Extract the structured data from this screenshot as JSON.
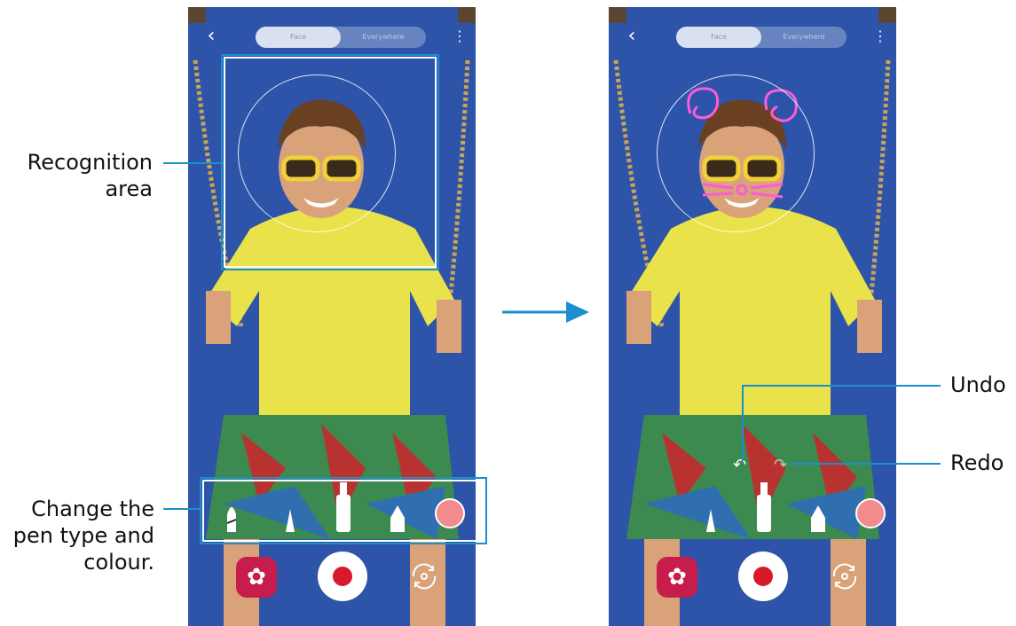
{
  "screens": [
    {
      "id": "before",
      "header": {
        "mode_tabs": [
          "Face",
          "Everywhere"
        ],
        "selected_tab": "Face"
      },
      "pen_options": {
        "pens": [
          "brush-pen",
          "marker-pen",
          "bottle-pen",
          "highlighter-pen"
        ],
        "selected_color": "#f08b8e"
      },
      "controls": {
        "sticker_icon": "flower-icon",
        "record_icon": "record-icon",
        "switch_icon": "switch-camera-icon"
      }
    },
    {
      "id": "after",
      "header": {
        "mode_tabs": [
          "Face",
          "Everywhere"
        ],
        "selected_tab": "Face"
      },
      "pen_options": {
        "pens": [
          "marker-pen",
          "bottle-pen",
          "highlighter-pen"
        ],
        "selected_color": "#f08b8e"
      },
      "controls": {
        "sticker_icon": "flower-icon",
        "record_icon": "record-icon",
        "switch_icon": "switch-camera-icon"
      },
      "drawing_icons": {
        "undo": "undo-icon",
        "redo": "redo-icon"
      }
    }
  ],
  "callouts": {
    "recognition_area": [
      "Recognition",
      "area"
    ],
    "change_pen": [
      "Change the",
      "pen type and",
      "colour."
    ],
    "undo": "Undo",
    "redo": "Redo"
  },
  "colors": {
    "accent": "#1b8ed1",
    "background": "#2d54a8",
    "record": "#d8192c",
    "sticker": "#c71d4c",
    "pen_color": "#f08b8e",
    "neon": "#ff5ad8"
  }
}
